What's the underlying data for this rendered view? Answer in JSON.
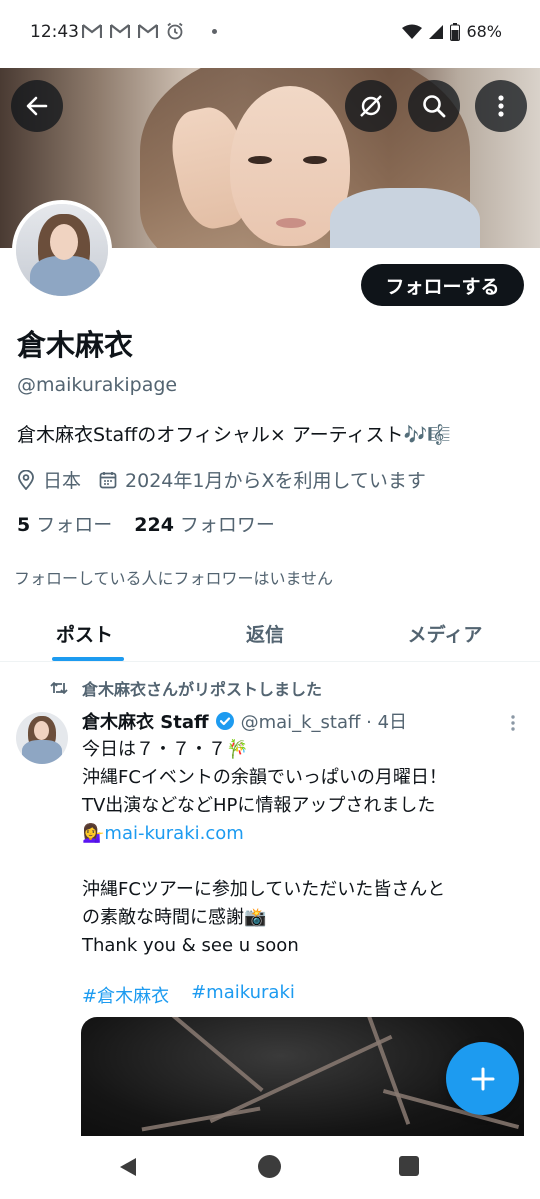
{
  "status_bar": {
    "time": "12:43",
    "battery": "68%",
    "icons": [
      "gmail-icon",
      "gmail-icon",
      "gmail-icon",
      "alarm-icon",
      "dot-icon",
      "wifi-icon",
      "signal-icon",
      "battery-icon"
    ]
  },
  "header": {
    "icons": [
      "back-arrow-icon",
      "grok-icon",
      "search-icon",
      "more-vertical-icon"
    ]
  },
  "profile": {
    "follow_label": "フォローする",
    "name": "倉木麻衣",
    "handle": "@maikurakipage",
    "bio": "倉木麻衣Staffのオフィシャル× アーティスト🎶🎼",
    "location": "日本",
    "joined": "2024年1月からXを利用しています",
    "following_count": "5",
    "following_label": "フォロー",
    "followers_count": "224",
    "followers_label": "フォロワー",
    "mutuals_note": "フォローしている人にフォロワーはいません"
  },
  "tabs": [
    {
      "label": "ポスト",
      "active": true
    },
    {
      "label": "返信",
      "active": false
    },
    {
      "label": "メディア",
      "active": false
    }
  ],
  "post": {
    "repost_label": "倉木麻衣さんがリポストしました",
    "author": "倉木麻衣 Staff",
    "handle_time": "@mai_k_staff · 4日",
    "lines": [
      "今日は７・７・７🎋",
      "沖縄FCイベントの余韻でいっぱいの月曜日！",
      "TV出演などなどHPに情報アップされました",
      "",
      "",
      "沖縄FCツアーに参加していただいた皆さんと",
      "の素敵な時間に感謝📸",
      "Thank you & see u soon"
    ],
    "link_emoji": "💁‍♀️",
    "link": "mai-kuraki.com",
    "hashtags": [
      "#倉木麻衣",
      "#maikuraki"
    ]
  },
  "colors": {
    "accent": "#1d9bf0",
    "text_primary": "#0f1419",
    "text_secondary": "#536471"
  }
}
